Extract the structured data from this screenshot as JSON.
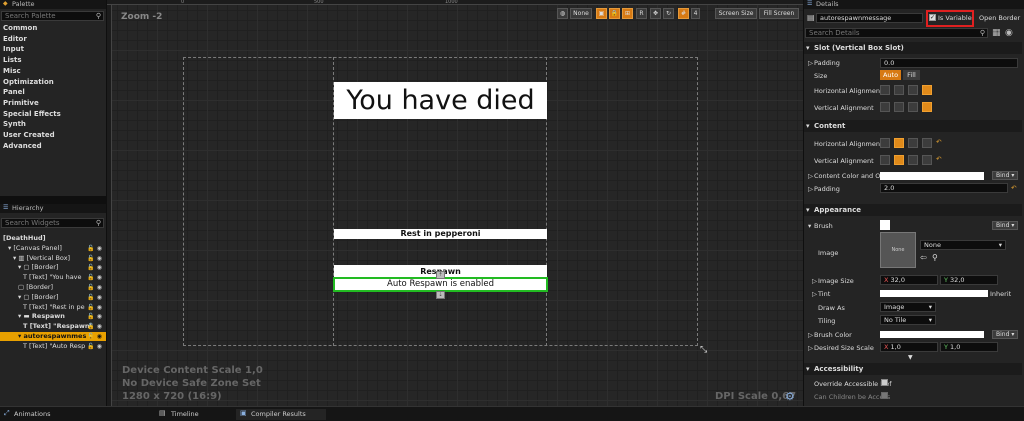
{
  "palette": {
    "tab": "Palette",
    "search_placeholder": "Search Palette",
    "items": [
      "Common",
      "Editor",
      "Input",
      "Lists",
      "Misc",
      "Optimization",
      "Panel",
      "Primitive",
      "Special Effects",
      "Synth",
      "User Created",
      "Advanced"
    ]
  },
  "hierarchy": {
    "tab": "Hierarchy",
    "search_placeholder": "Search Widgets",
    "rows": [
      {
        "label": "[DeathHud]",
        "indent": 0
      },
      {
        "label": "▾ [Canvas Panel]",
        "indent": 1
      },
      {
        "label": "▾ ▥ [Vertical Box]",
        "indent": 2
      },
      {
        "label": "▾ ▢ [Border]",
        "indent": 3
      },
      {
        "label": "T [Text] \"You have",
        "indent": 4
      },
      {
        "label": "▢ [Border]",
        "indent": 3
      },
      {
        "label": "▾ ▢ [Border]",
        "indent": 3
      },
      {
        "label": "T [Text] \"Rest in pe",
        "indent": 4
      },
      {
        "label": "▾ ▬ Respawn",
        "indent": 3
      },
      {
        "label": "T [Text] \"Respawn\"",
        "indent": 4
      },
      {
        "label": "▾ autorespawnmes",
        "indent": 3,
        "selected": true
      },
      {
        "label": "T [Text] \"Auto Resp",
        "indent": 4
      }
    ]
  },
  "canvas": {
    "zoom": "Zoom -2",
    "ruler_marks": [
      "0",
      "500",
      "1000"
    ],
    "title_text": "You have died",
    "rest_text": "Rest in pepperoni",
    "respawn_text": "Respawn",
    "auto_text": "Auto Respawn is enabled",
    "info_line1": "Device Content Scale 1,0",
    "info_line2": "No Device Safe Zone Set",
    "info_line3": "1280 x 720 (16:9)",
    "dpi": "DPI Scale 0,67"
  },
  "toolbar": {
    "none_label": "None",
    "r_label": "R",
    "grid_value": "4",
    "screen_size": "Screen Size",
    "fill_screen": "Fill Screen"
  },
  "details": {
    "tab": "Details",
    "name_value": "autorespawnmessage",
    "is_variable_label": "Is Variable",
    "is_variable_checked": true,
    "open_border": "Open Border",
    "search_placeholder": "Search Details",
    "slot_section": "Slot (Vertical Box Slot)",
    "padding_label": "Padding",
    "padding_value": "0.0",
    "size_label": "Size",
    "size_auto": "Auto",
    "size_fill": "Fill",
    "halign_label": "Horizontal Alignmen",
    "valign_label": "Vertical Alignment",
    "content_section": "Content",
    "c_halign_label": "Horizontal Alignmen",
    "c_valign_label": "Vertical Alignment",
    "content_color_label": "Content Color and Op",
    "bind_label": "Bind",
    "c_padding_label": "Padding",
    "c_padding_value": "2.0",
    "appearance_section": "Appearance",
    "brush_label": "Brush",
    "image_label": "Image",
    "image_preview": "None",
    "image_value": "None",
    "image_size_label": "Image Size",
    "image_size_x": "32,0",
    "image_size_y": "32,0",
    "tint_label": "Tint",
    "inherit_label": "Inherit",
    "draw_as_label": "Draw As",
    "draw_as_value": "Image",
    "tiling_label": "Tiling",
    "tiling_value": "No Tile",
    "brush_color_label": "Brush Color",
    "desired_size_label": "Desired Size Scale",
    "desired_x": "1,0",
    "desired_y": "1,0",
    "accessibility_section": "Accessibility",
    "override_label": "Override Accessible Def",
    "can_children_label": "Can Children be Access"
  },
  "bottom_tabs": [
    "Animations",
    "Timeline",
    "Compiler Results"
  ],
  "colors": {
    "accent": "#e08a1a",
    "selection": "#e8a000",
    "highlight_box": "#e02020",
    "selected_widget": "#22bb22"
  }
}
